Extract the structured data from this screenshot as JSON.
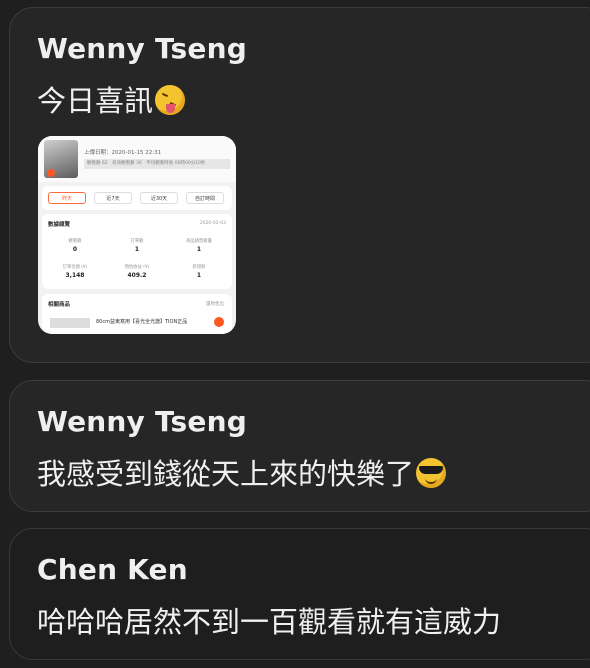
{
  "messages": [
    {
      "sender": "Wenny Tseng",
      "text": "今日喜訊",
      "emoji": "squinting-face-with-tongue-icon",
      "attachment": {
        "date": "上傳日期：2020-01-15 22:31",
        "bar": "觀看數 62　有效觀看數 36　平均觀看時長 00時00分10秒",
        "tabs": [
          "昨天",
          "近7天",
          "近30天",
          "自訂時間"
        ],
        "data_title": "數據總覽",
        "data_date": "2020-02-03",
        "metrics": [
          {
            "label": "觀看數",
            "value": "0"
          },
          {
            "label": "訂單數",
            "value": "1"
          },
          {
            "label": "商品銷售數量",
            "value": "1"
          },
          {
            "label": "訂單金額 (¥)",
            "value": "3,148"
          },
          {
            "label": "預估收益 (¥)",
            "value": "409.2"
          },
          {
            "label": "新增粉",
            "value": "1"
          }
        ],
        "goods_title": "相關商品",
        "goods_sort": "還原售出",
        "goods_item": "80cm益東寫用【喜光全光譜】TION正品"
      }
    },
    {
      "sender": "Wenny Tseng",
      "text": "我感受到錢從天上來的快樂了",
      "emoji": "smiling-face-with-sunglasses-icon"
    },
    {
      "sender": "Chen Ken",
      "text": "哈哈哈居然不到一百觀看就有這威力"
    }
  ]
}
